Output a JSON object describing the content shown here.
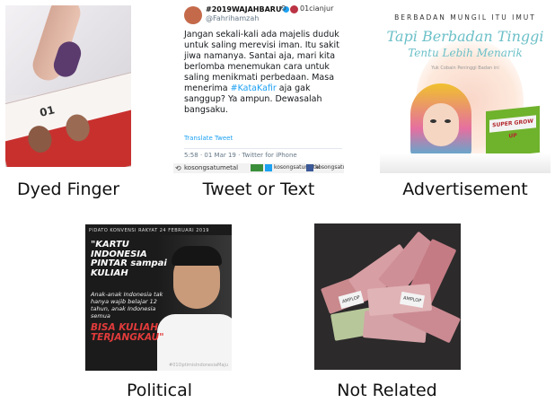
{
  "categories": [
    {
      "caption": "Dyed Finger"
    },
    {
      "caption": "Tweet or Text"
    },
    {
      "caption": "Advertisement"
    },
    {
      "caption": "Political"
    },
    {
      "caption": "Not Related"
    }
  ],
  "ballot": {
    "number": "01"
  },
  "tweet": {
    "handle": "#2019WAJAHBARU",
    "username": "@Fahrihamzah",
    "retweeter": "01cianjur",
    "body_before": "Jangan sekali-kali ada majelis duduk untuk saling merevisi iman. Itu sakit jiwa namanya. Santai aja, mari kita berlomba menemukan cara untuk saling menikmati perbedaan. Masa menerima ",
    "hashtag": "#KataKafir",
    "body_after": " aja gak sanggup? Ya ampun. Dewasalah bangsaku.",
    "translate": "Translate Tweet",
    "meta": "5:58 · 01 Mar 19 · Twitter for iPhone",
    "footer_name": "kosongsatumetal",
    "footer_twitter": "kosongsatumetal",
    "footer_facebook": "kosongsatumetal"
  },
  "ad": {
    "top_text": "BERBADAN MUNGIL ITU IMUT",
    "script_line1": "Tapi Berbadan Tinggi",
    "script_line2": "Tentu Lebih Menarik",
    "sub_text": "Yuk Cobain Peninggi Badan ini",
    "product_label": "SUPER GROW UP"
  },
  "political": {
    "header": "PIDATO KONVENSI RAKYAT 24 FEBRUARI 2019",
    "quote_bold": "\"KARTU INDONESIA PINTAR sampai KULIAH",
    "quote_small": "Anak-anak Indonesia tak hanya wajib belajar 12 tahun, anak Indonesia semua",
    "quote_red": "BISA KULIAH TERJANGKAU\"",
    "hashtag": "#01OptimisIndonesiaMaju"
  },
  "money": {
    "card1": "AMPLOP",
    "card2": "AMPLOP"
  }
}
